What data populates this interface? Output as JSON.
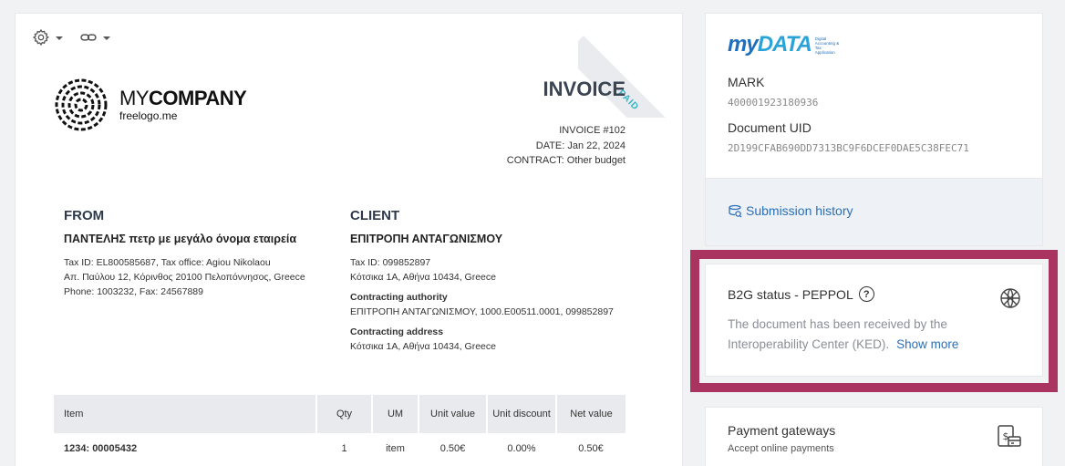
{
  "invoice": {
    "ribbon": "PAID",
    "logo": {
      "name_light": "MY",
      "name_bold": "COMPANY",
      "sub": "freelogo.me"
    },
    "title": "INVOICE",
    "number": "INVOICE #102",
    "date": "DATE: Jan 22, 2024",
    "contract": "CONTRACT: Other budget",
    "from": {
      "heading": "FROM",
      "name": "ΠΑΝΤΕΛΗΣ πετρ με μεγάλο όνομα εταιρεία",
      "lines": [
        "Tax ID: EL800585687, Tax office: Agiou Nikolaou",
        "Απ. Παύλου 12, Κόρινθος 20100 Πελοπόννησος, Greece",
        "Phone: 1003232, Fax: 24567889"
      ]
    },
    "client": {
      "heading": "CLIENT",
      "name": "ΕΠΙΤΡΟΠΗ ΑΝΤΑΓΩΝΙΣΜΟΥ",
      "lines": [
        "Tax ID: 099852897",
        "Κότσικα 1Α, Αθήνα 10434, Greece"
      ],
      "contracting_authority_label": "Contracting authority",
      "contracting_authority": "ΕΠΙΤΡΟΠΗ ΑΝΤΑΓΩΝΙΣΜΟΥ, 1000.Ε00511.0001, 099852897",
      "contracting_address_label": "Contracting address",
      "contracting_address": "Κότσικα 1Α, Αθήνα 10434, Greece"
    },
    "table": {
      "headers": [
        "Item",
        "Qty",
        "UM",
        "Unit value",
        "Unit discount",
        "Net value"
      ],
      "rows": [
        [
          "1234: 00005432",
          "1",
          "item",
          "0.50€",
          "0.00%",
          "0.50€"
        ]
      ]
    }
  },
  "mydata": {
    "brand_my": "my",
    "brand_data": "DATA",
    "tagline": [
      "Digital",
      "Accounting &",
      "Tax",
      "Application"
    ],
    "mark_label": "MARK",
    "mark_value": "400001923180936",
    "uid_label": "Document UID",
    "uid_value": "2D199CFAB690DD7313BC9F6DCEF0DAE5C38FEC71",
    "submission_history": "Submission history"
  },
  "b2g": {
    "title": "B2G status - PEPPOL",
    "help": "?",
    "description": "The document has been received by the Interoperability Center (KED).",
    "show_more": "Show more",
    "highlight_color": "#a8345f"
  },
  "payment": {
    "title": "Payment gateways",
    "subtitle": "Accept online payments"
  }
}
